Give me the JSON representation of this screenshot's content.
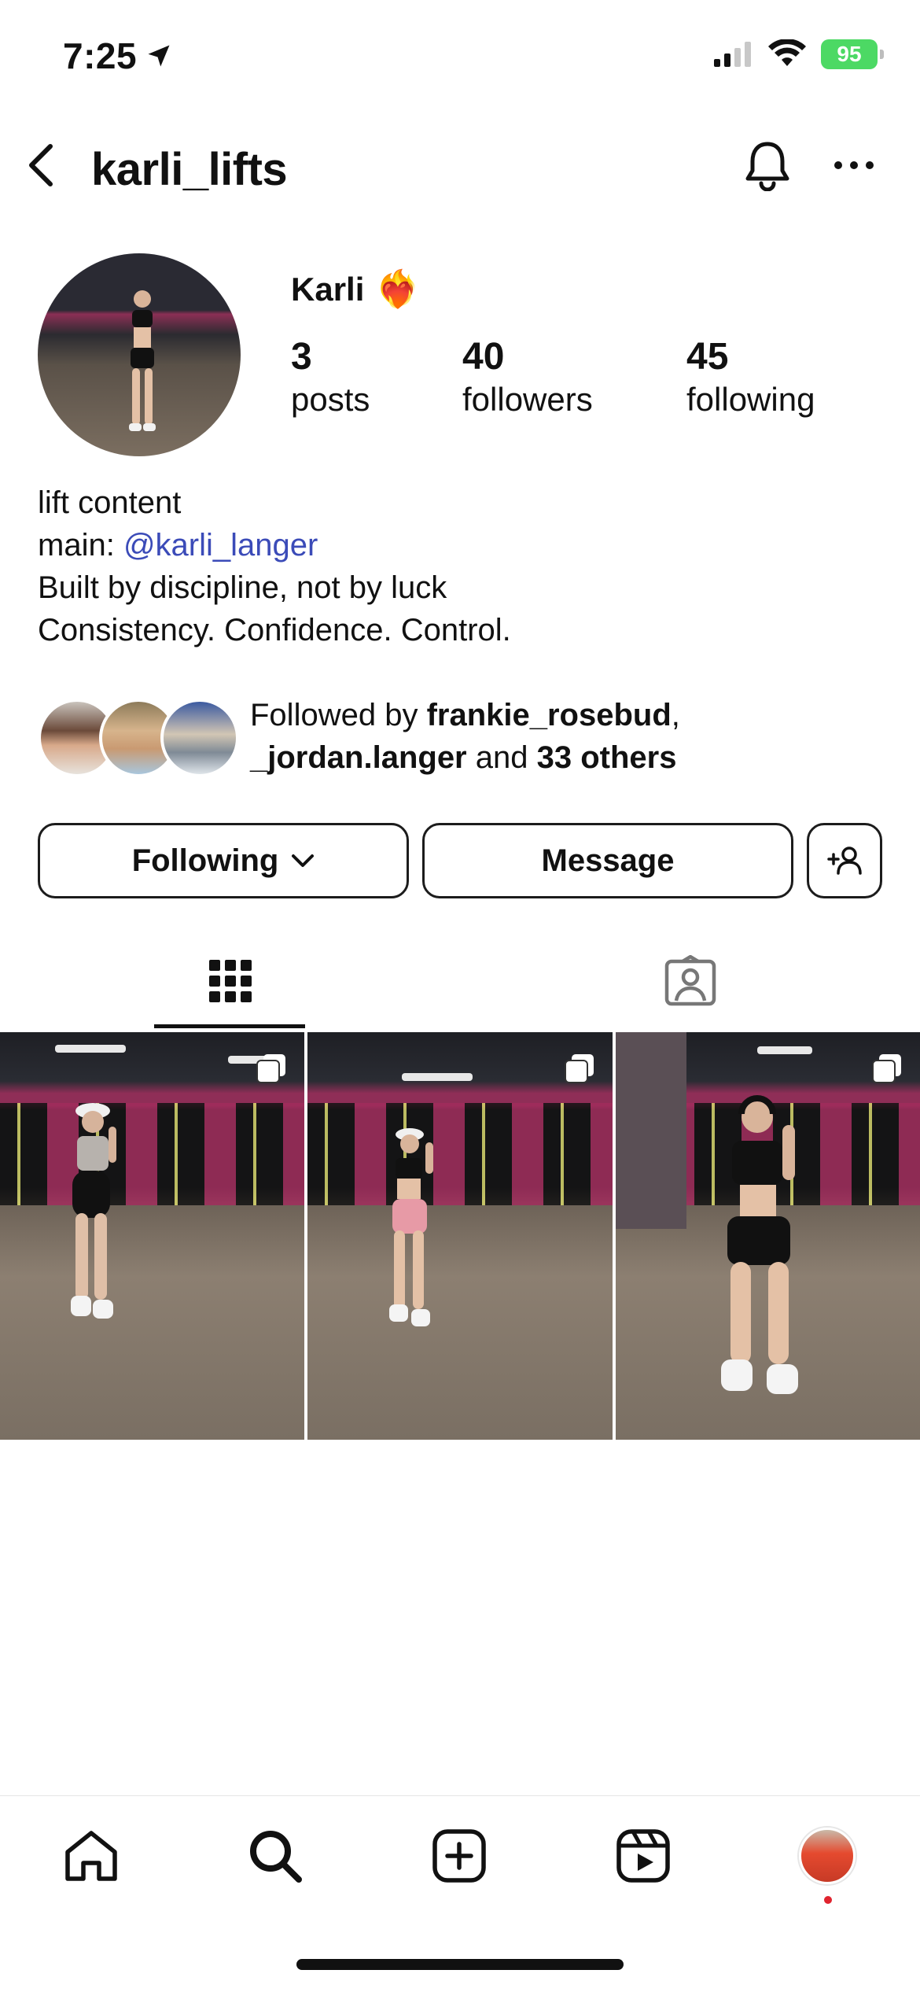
{
  "status_bar": {
    "time": "7:25",
    "battery": "95"
  },
  "header": {
    "username": "karli_lifts"
  },
  "profile": {
    "display_name": "Karli",
    "display_name_emoji": "❤️‍🔥",
    "stats": [
      {
        "count": "3",
        "label": "posts"
      },
      {
        "count": "40",
        "label": "followers"
      },
      {
        "count": "45",
        "label": "following"
      }
    ],
    "bio": {
      "line1": "lift content",
      "line2_prefix": "main: ",
      "line2_mention": "@karli_langer",
      "line3": "Built by discipline, not by luck",
      "line4": "Consistency. Confidence. Control."
    },
    "followed_by": {
      "prefix": "Followed by ",
      "user1": "frankie_rosebud",
      "sep": ",",
      "user2": "_jordan.langer",
      "mid": " and ",
      "others": "33 others"
    }
  },
  "actions": {
    "following_label": "Following",
    "message_label": "Message"
  },
  "tabs": [
    {
      "name": "posts-grid",
      "icon": "grid-icon",
      "active": true
    },
    {
      "name": "tagged",
      "icon": "tagged-person-icon",
      "active": false
    }
  ],
  "posts": [
    {
      "type": "carousel",
      "icon": "multiple-posts-icon"
    },
    {
      "type": "carousel",
      "icon": "multiple-posts-icon"
    },
    {
      "type": "carousel",
      "icon": "multiple-posts-icon"
    }
  ],
  "bottom_nav": [
    {
      "name": "home",
      "icon": "home-icon"
    },
    {
      "name": "search",
      "icon": "search-icon"
    },
    {
      "name": "create",
      "icon": "plus-square-icon"
    },
    {
      "name": "reels",
      "icon": "reels-icon"
    },
    {
      "name": "profile",
      "icon": "profile-avatar"
    }
  ],
  "colors": {
    "mention": "#3b4bb8",
    "battery": "#4cd964",
    "notification_dot": "#e0242f"
  }
}
